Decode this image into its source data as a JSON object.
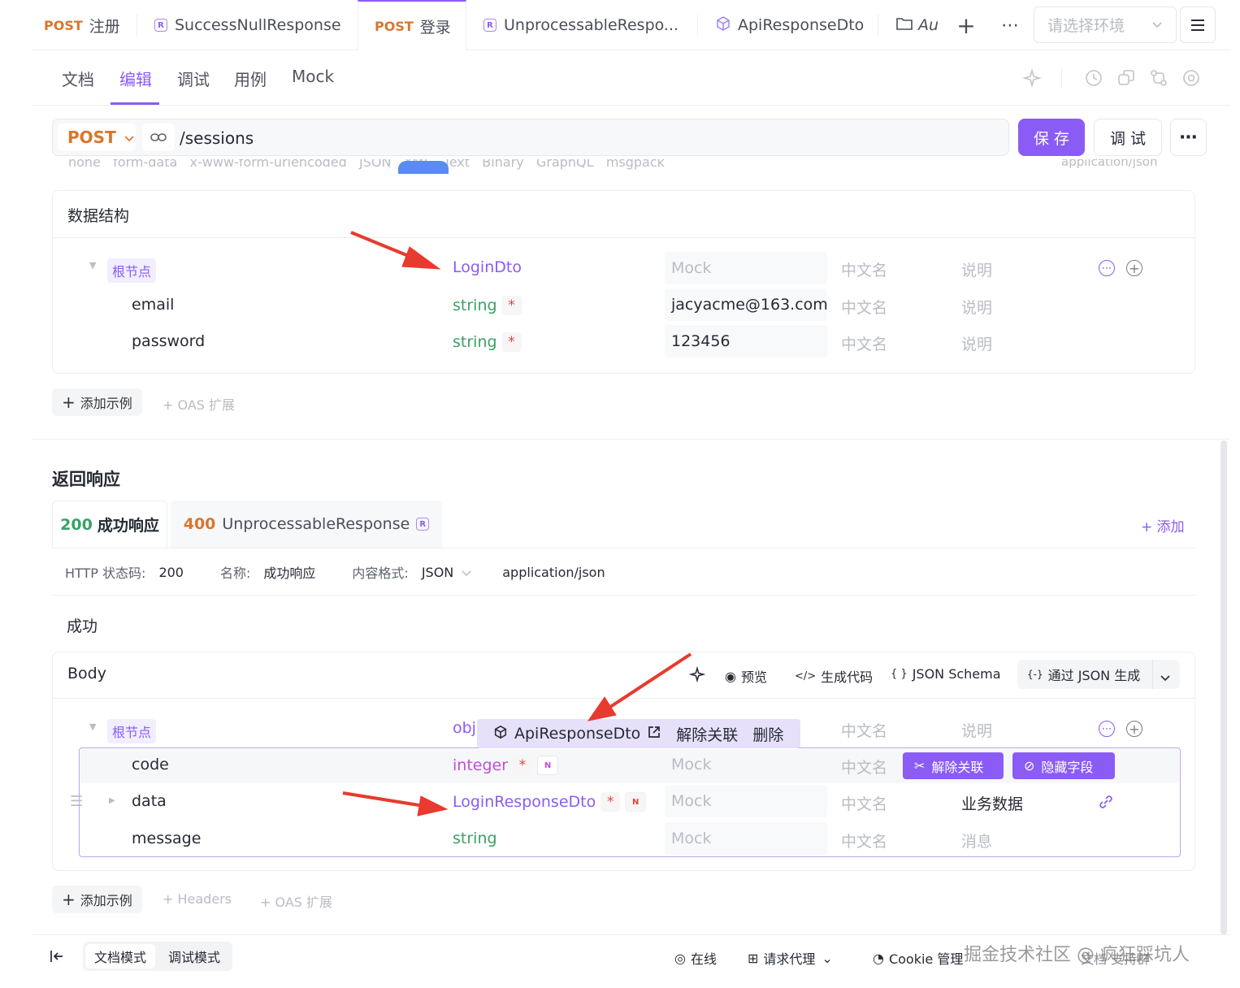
{
  "tabs": [
    {
      "method": "POST",
      "label": "注册"
    },
    {
      "badge": "R",
      "label": "SuccessNullResponse"
    },
    {
      "method": "POST",
      "label": "登录"
    },
    {
      "badge": "R",
      "label": "UnprocessableRespo..."
    },
    {
      "label": "ApiResponseDto"
    },
    {
      "label": "Au"
    }
  ],
  "env_select_placeholder": "请选择环境",
  "subnav": [
    "文档",
    "编辑",
    "调试",
    "用例",
    "Mock"
  ],
  "request": {
    "method": "POST",
    "path": "/sessions",
    "save": "保 存",
    "debug": "调 试"
  },
  "body_types_partial": "none   form-data   x-www-form-urlencoded   JSON   XML   Text   Binary   GraphQL   msgpack",
  "content_type_partial": "application/json",
  "schema": {
    "title": "数据结构",
    "root_label": "根节点",
    "root_type": "LoginDto",
    "placeholders": {
      "mock": "Mock",
      "cn_name": "中文名",
      "desc": "说明"
    },
    "fields": [
      {
        "name": "email",
        "type": "string",
        "required": "*",
        "mock": "jacyacme@163.com"
      },
      {
        "name": "password",
        "type": "string",
        "required": "*",
        "mock": "123456"
      }
    ],
    "add_example": "添加示例",
    "oas": "OAS 扩展"
  },
  "response": {
    "title": "返回响应",
    "tabs": [
      {
        "code": "200",
        "label": "成功响应"
      },
      {
        "code": "400",
        "label": "UnprocessableResponse",
        "badge": "R"
      }
    ],
    "add": "添加",
    "meta": {
      "status_label": "HTTP 状态码:",
      "status": "200",
      "name_label": "名称:",
      "name": "成功响应",
      "format_label": "内容格式:",
      "format": "JSON",
      "mime": "application/json"
    },
    "desc": "成功",
    "body_label": "Body",
    "toolbar": {
      "preview": "预览",
      "gencode": "生成代码",
      "schema": "JSON Schema",
      "from_json": "通过 JSON 生成"
    },
    "root_label": "根节点",
    "root_type_partial": "obj",
    "popover": {
      "ref": "ApiResponseDto",
      "unlink": "解除关联",
      "delete": "删除"
    },
    "fields": [
      {
        "name": "code",
        "type": "integer",
        "required": "*",
        "nullable": "N",
        "mock": "Mock",
        "cn_name": "中文名"
      },
      {
        "name": "data",
        "type": "LoginResponseDto",
        "required": "*",
        "nullable": "N",
        "mock": "Mock",
        "cn_name": "中文名",
        "desc": "业务数据"
      },
      {
        "name": "message",
        "type": "string",
        "mock": "Mock",
        "cn_name": "中文名",
        "desc": "消息"
      }
    ],
    "row_actions": {
      "unlink": "解除关联",
      "hide": "隐藏字段"
    },
    "add_example": "添加示例",
    "headers": "Headers",
    "oas": "OAS 扩展"
  },
  "footer": {
    "doc_mode": "文档模式",
    "debug_mode": "调试模式",
    "online": "在线",
    "proxy": "请求代理",
    "cookie": "Cookie 管理",
    "watermark": "掘金技术社区 @ 疯狂踩坑人",
    "partial_right": "文档 支持群"
  },
  "colors": {
    "accent": "#8a5cf5",
    "post": "#d9762d",
    "success": "#3aa167",
    "error": "#e0443d"
  }
}
